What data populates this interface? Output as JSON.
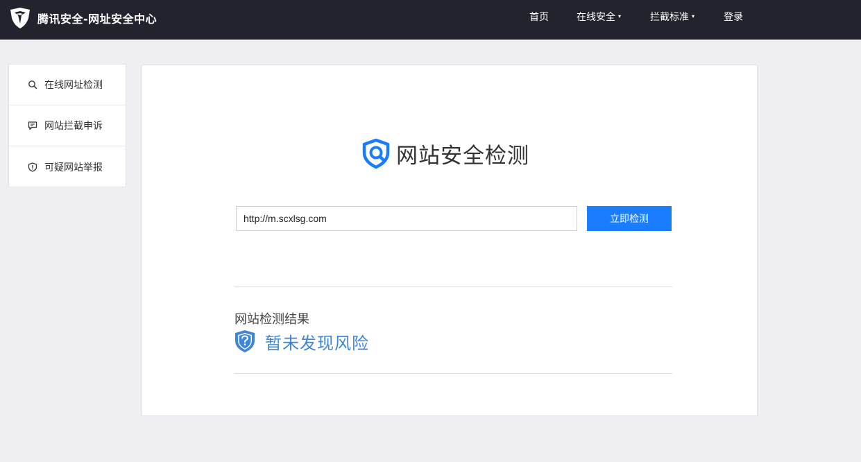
{
  "header": {
    "brand_name": "腾讯安全-网址安全中心",
    "logo_icon": "tencent-security-logo",
    "nav": [
      {
        "label": "首页",
        "has_dropdown": false
      },
      {
        "label": "在线安全",
        "has_dropdown": true
      },
      {
        "label": "拦截标准",
        "has_dropdown": true
      },
      {
        "label": "登录",
        "has_dropdown": false
      }
    ],
    "caret_glyph": "▾"
  },
  "sidebar": {
    "items": [
      {
        "label": "在线网址检测",
        "icon": "search-icon"
      },
      {
        "label": "网站拦截申诉",
        "icon": "chat-bubble-icon"
      },
      {
        "label": "可疑网站举报",
        "icon": "alert-shield-icon"
      }
    ]
  },
  "main": {
    "title": "网站安全检测",
    "title_icon": "shield-search-icon",
    "url_input": {
      "value": "http://m.scxlsg.com",
      "placeholder": ""
    },
    "check_button_label": "立即检测",
    "result": {
      "section_label": "网站检测结果",
      "status_icon": "question-shield-icon",
      "status_text": "暂未发现风险"
    }
  },
  "colors": {
    "header_bg": "#22232d",
    "page_bg": "#efeff3",
    "accent_blue": "#1a7cff",
    "status_blue": "#3f86d9"
  }
}
